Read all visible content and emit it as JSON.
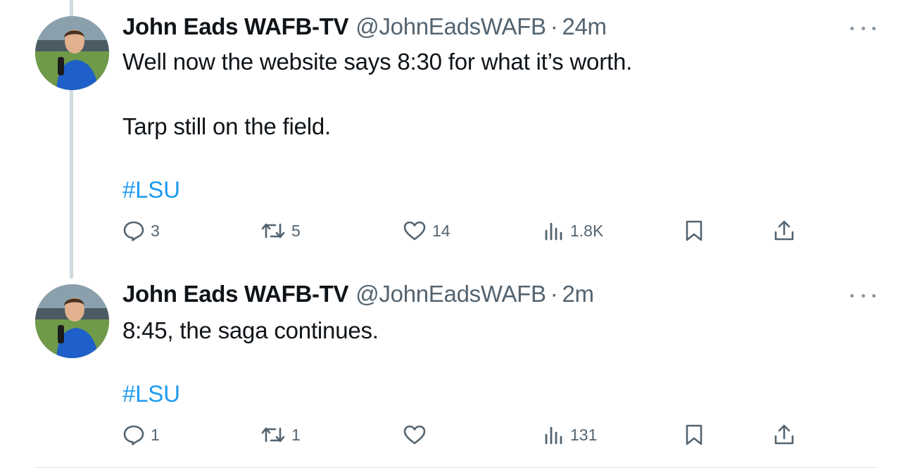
{
  "tweets": [
    {
      "display_name": "John Eads WAFB-TV",
      "handle": "@JohnEadsWAFB",
      "separator": "·",
      "time": "24m",
      "text_lines": [
        "Well now the website says 8:30 for what it’s worth.",
        "Tarp still on the field."
      ],
      "hashtag": "#LSU",
      "stats": {
        "replies": "3",
        "reposts": "5",
        "likes": "14",
        "views": "1.8K"
      }
    },
    {
      "display_name": "John Eads WAFB-TV",
      "handle": "@JohnEadsWAFB",
      "separator": "·",
      "time": "2m",
      "text_lines": [
        "8:45, the saga continues."
      ],
      "hashtag": "#LSU",
      "stats": {
        "replies": "1",
        "reposts": "1",
        "likes": "",
        "views": "131"
      }
    }
  ],
  "colors": {
    "text_primary": "#0f1419",
    "text_secondary": "#536471",
    "link": "#1d9bf0",
    "thread_line": "#cfd9de"
  },
  "icons": [
    "reply-icon",
    "repost-icon",
    "like-icon",
    "views-icon",
    "bookmark-icon",
    "share-icon",
    "more-icon"
  ]
}
